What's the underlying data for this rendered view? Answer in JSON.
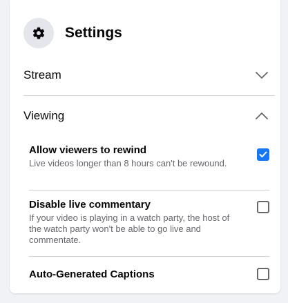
{
  "header": {
    "title": "Settings",
    "icon": "gear-icon"
  },
  "sections": [
    {
      "label": "Stream",
      "state": "collapsed",
      "icon": "chevron-down-icon"
    },
    {
      "label": "Viewing",
      "state": "expanded",
      "icon": "chevron-up-icon"
    }
  ],
  "viewing_options": [
    {
      "title": "Allow viewers to rewind",
      "description": "Live videos longer than 8 hours can't be rewound.",
      "checked": true
    },
    {
      "title": "Disable live commentary",
      "description": "If your video is playing in a watch party, the host of the watch party won't be able to go live and commentate.",
      "checked": false
    },
    {
      "title": "Auto-Generated Captions",
      "description": "",
      "checked": false
    }
  ],
  "colors": {
    "accent": "#1877f2",
    "text_primary": "#050505",
    "text_secondary": "#65676b",
    "divider": "#ced0d4",
    "icon_circle": "#e4e6eb",
    "background": "#f0f2f5"
  }
}
